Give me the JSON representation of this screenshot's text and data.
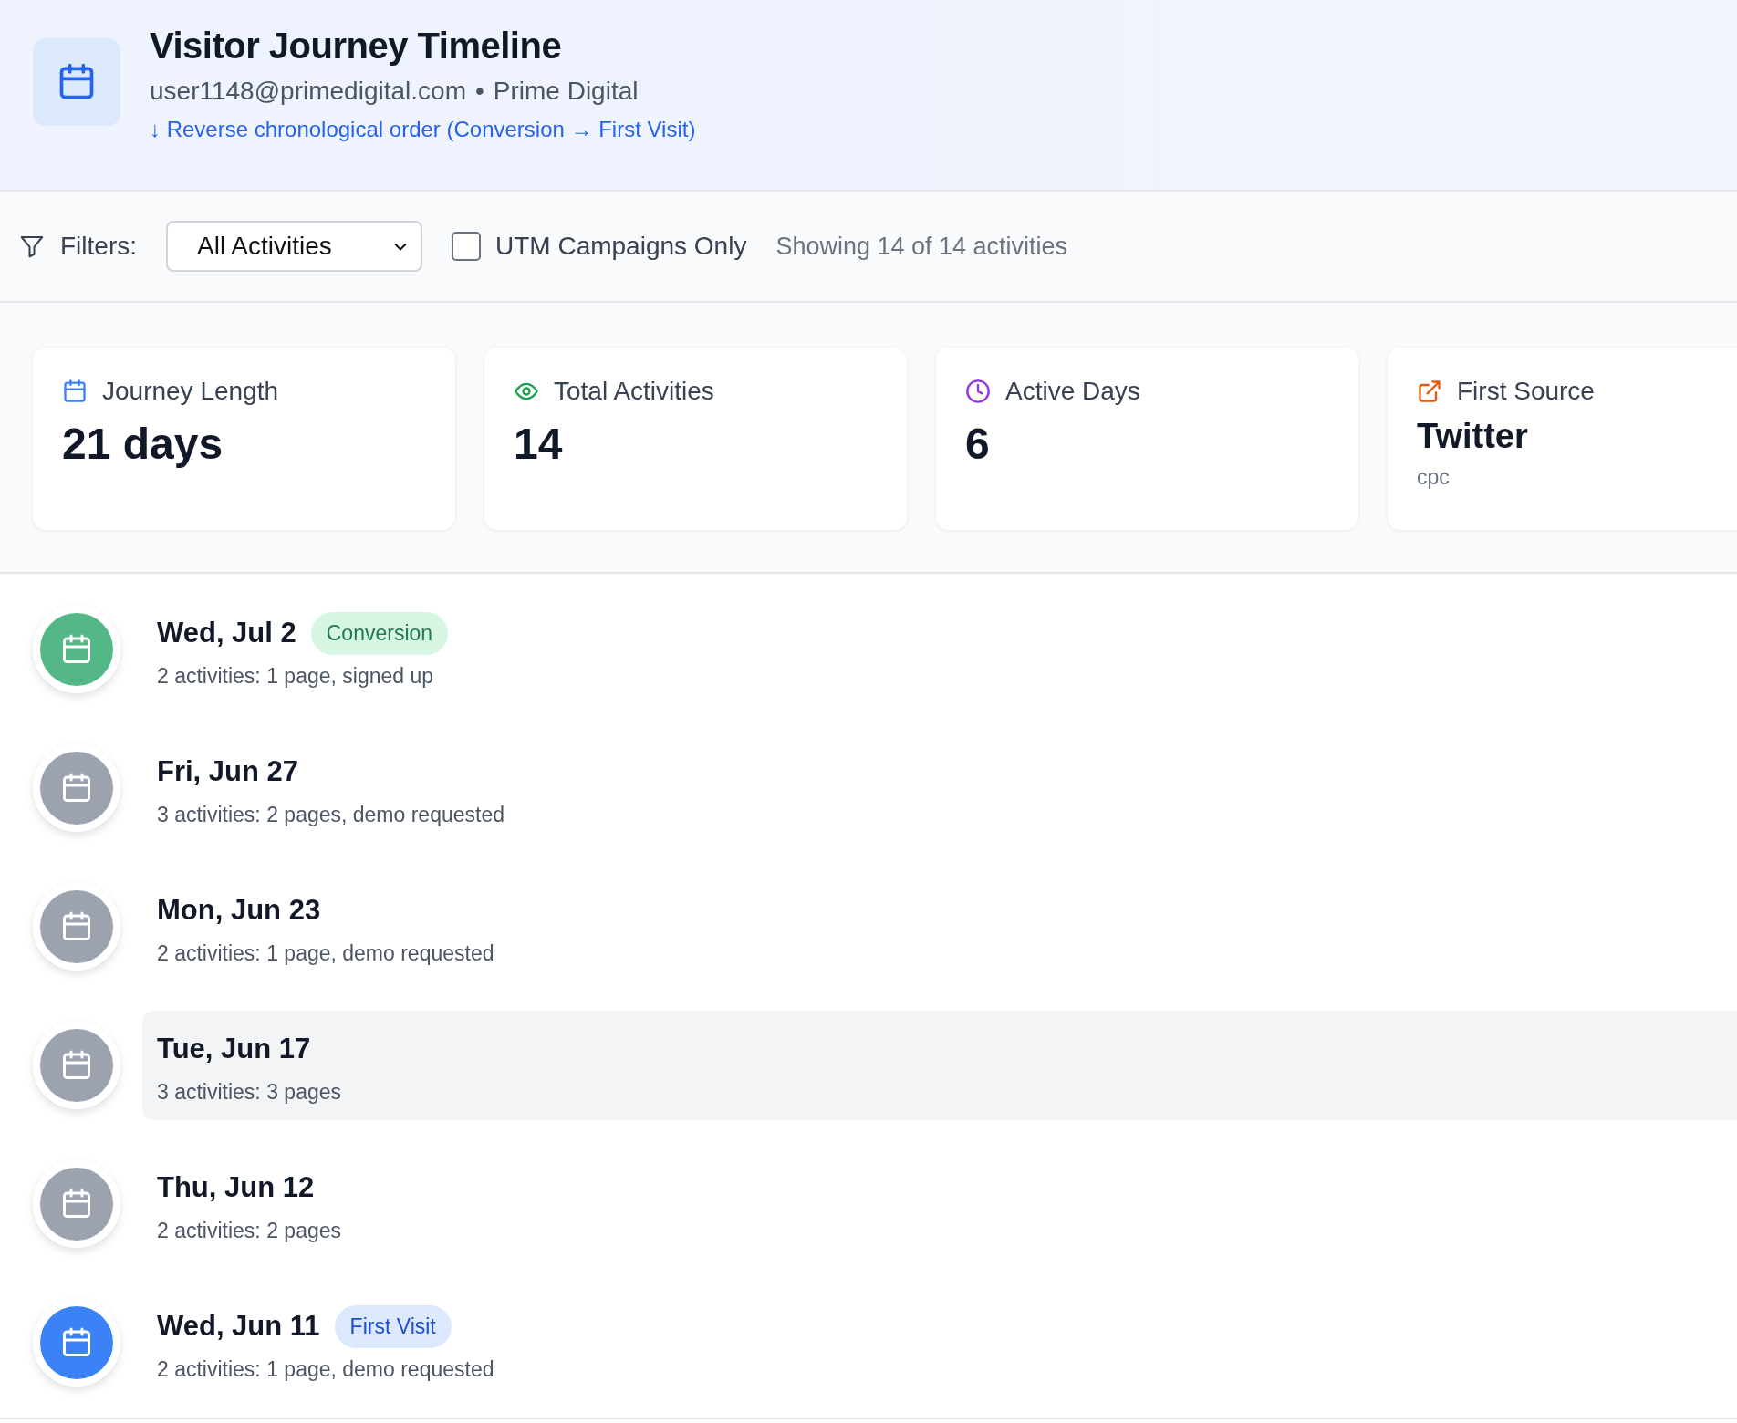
{
  "header": {
    "title": "Visitor Journey Timeline",
    "email": "user1148@primedigital.com",
    "separator": "•",
    "company": "Prime Digital",
    "order_note": "↓ Reverse chronological order (Conversion → First Visit)"
  },
  "filters": {
    "label": "Filters:",
    "select_value": "All Activities",
    "utm_only": {
      "label": "UTM Campaigns Only",
      "checked": false
    },
    "count_text": "Showing 14 of 14 activities"
  },
  "stats": [
    {
      "kind": "calendar",
      "color": "#3b82f6",
      "label": "Journey Length",
      "value": "21 days"
    },
    {
      "kind": "eye",
      "color": "#16a34a",
      "label": "Total Activities",
      "value": "14"
    },
    {
      "kind": "clock",
      "color": "#9333ea",
      "label": "Active Days",
      "value": "6"
    },
    {
      "kind": "external",
      "color": "#ea580c",
      "label": "First Source",
      "value": "Twitter",
      "sub": "cpc"
    }
  ],
  "timeline": [
    {
      "kind": "conversion",
      "date": "Wed, Jul 2",
      "badge": "Conversion",
      "summary": "2 activities: 1 page, signed up",
      "highlighted": false
    },
    {
      "kind": "normal",
      "date": "Fri, Jun 27",
      "summary": "3 activities: 2 pages, demo requested",
      "highlighted": false
    },
    {
      "kind": "normal",
      "date": "Mon, Jun 23",
      "summary": "2 activities: 1 page, demo requested",
      "highlighted": false
    },
    {
      "kind": "normal",
      "date": "Tue, Jun 17",
      "summary": "3 activities: 3 pages",
      "highlighted": true
    },
    {
      "kind": "normal",
      "date": "Thu, Jun 12",
      "summary": "2 activities: 2 pages",
      "highlighted": false
    },
    {
      "kind": "first",
      "date": "Wed, Jun 11",
      "badge": "First Visit",
      "summary": "2 activities: 1 page, demo requested",
      "highlighted": false
    }
  ]
}
